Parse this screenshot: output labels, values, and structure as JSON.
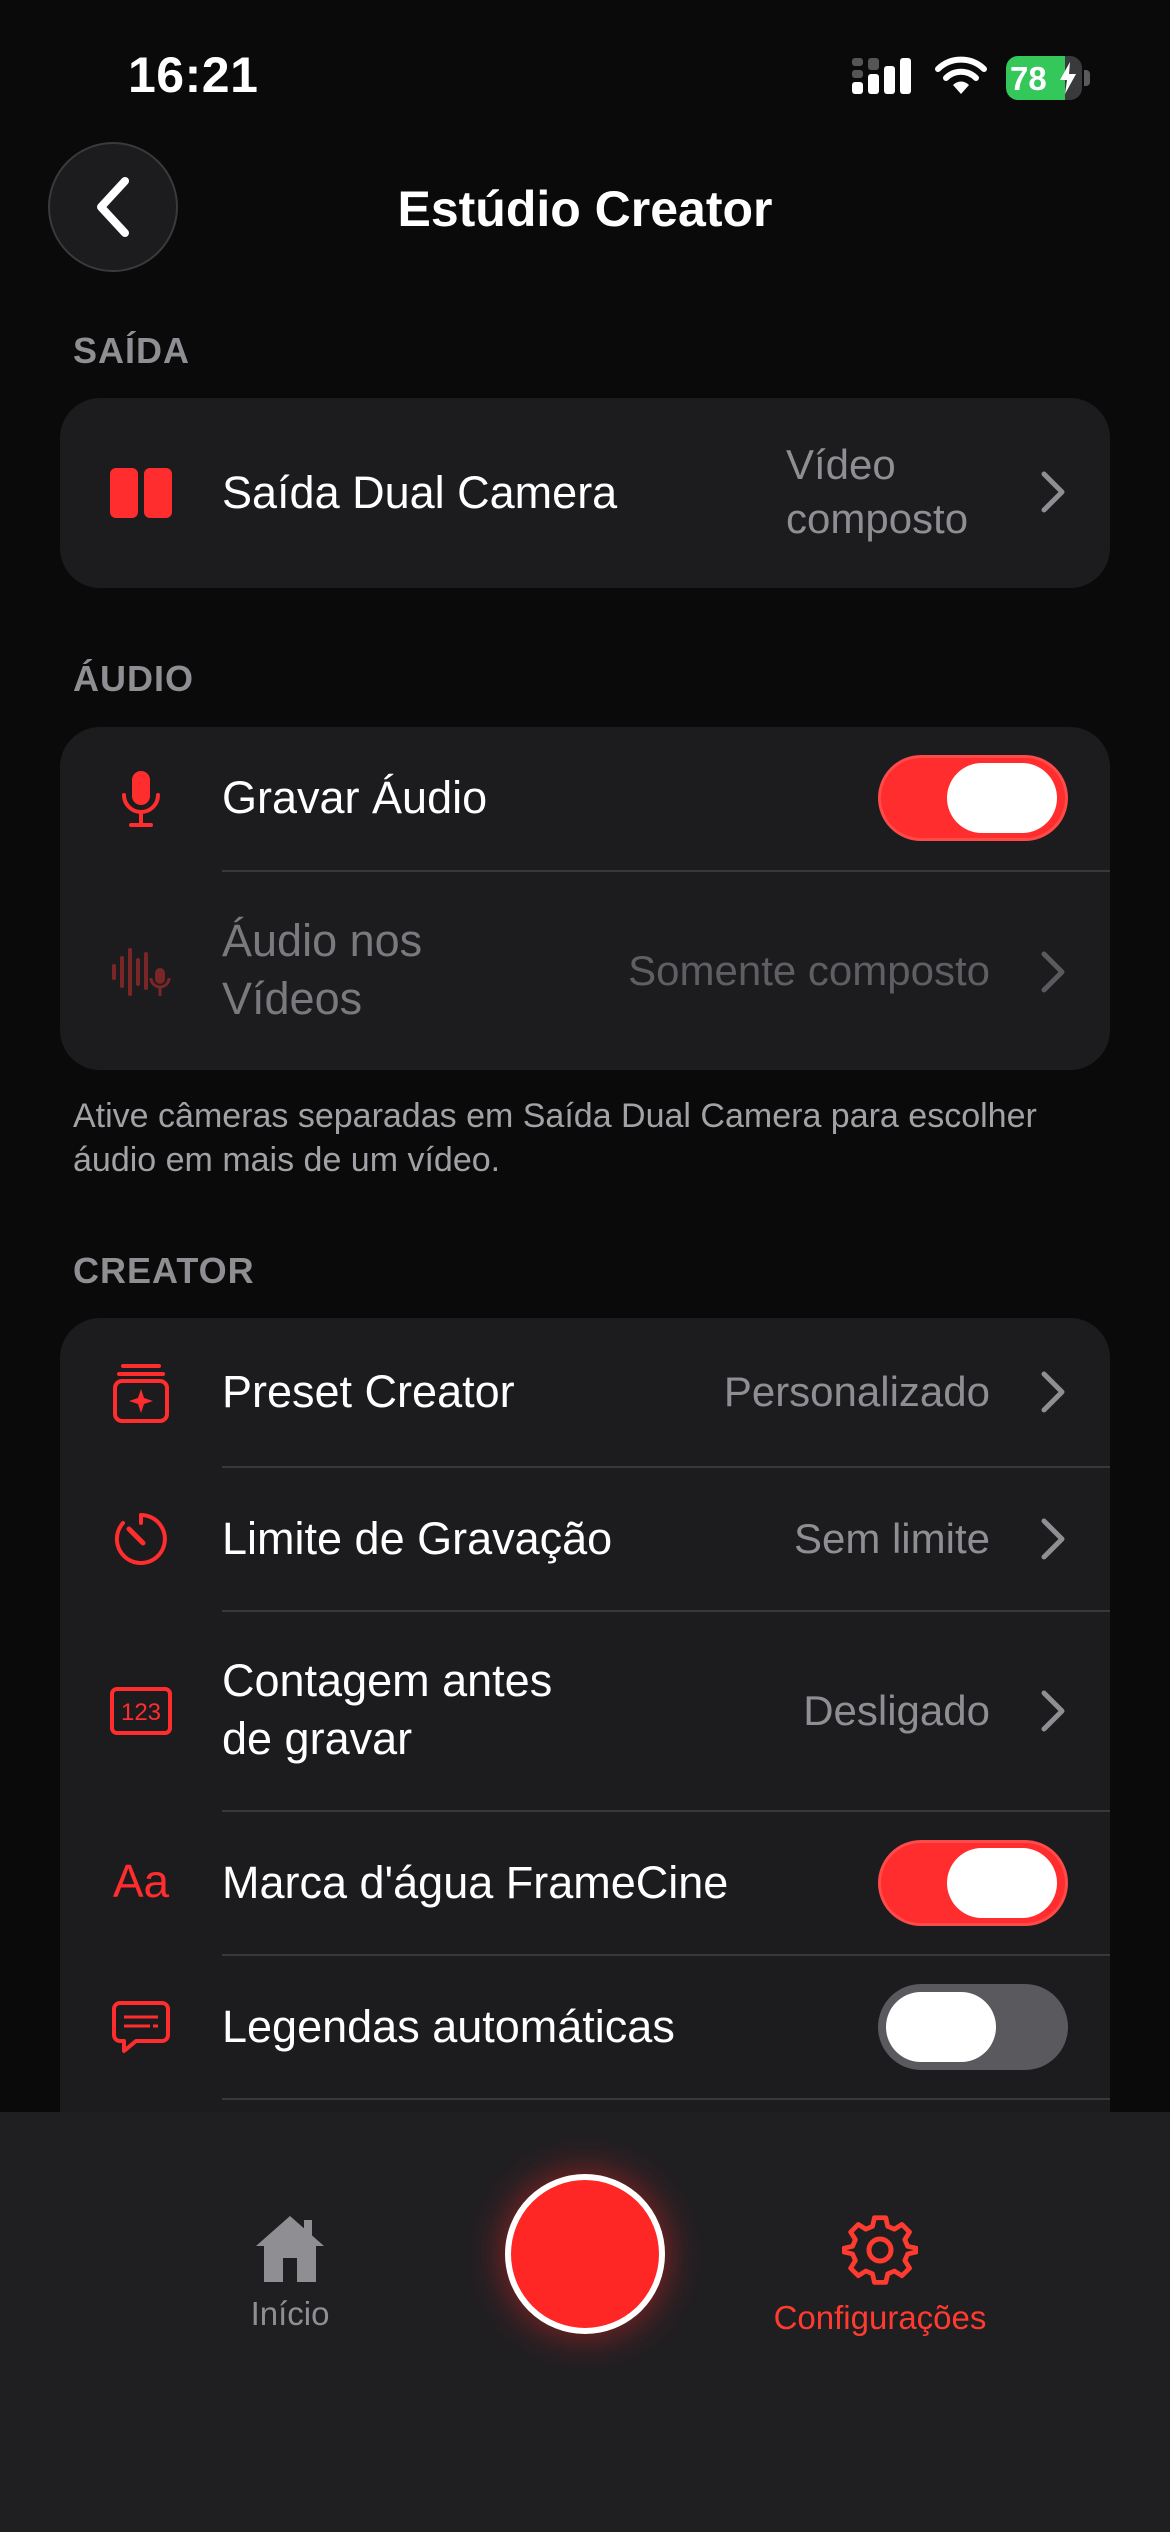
{
  "status_bar": {
    "time": "16:21",
    "battery": "78",
    "battery_fraction": 0.78
  },
  "header": {
    "title": "Estúdio Creator"
  },
  "sections": {
    "output": {
      "header": "SAÍDA",
      "dual_camera": {
        "label": "Saída Dual Camera",
        "value_line1": "Vídeo",
        "value_line2": "composto"
      }
    },
    "audio": {
      "header": "ÁUDIO",
      "record_audio": {
        "label": "Gravar Áudio",
        "on": true
      },
      "audio_in_videos": {
        "label_line1": "Áudio nos",
        "label_line2": "Vídeos",
        "value": "Somente composto"
      },
      "footnote": "Ative câmeras separadas em Saída Dual Camera para escolher áudio em mais de um vídeo."
    },
    "creator": {
      "header": "CREATOR",
      "preset": {
        "label": "Preset Creator",
        "value": "Personalizado"
      },
      "limit": {
        "label": "Limite de Gravação",
        "value": "Sem limite"
      },
      "countdown": {
        "label_line1": "Contagem antes",
        "label_line2": "de gravar",
        "value": "Desligado"
      },
      "watermark": {
        "icon_text": "Aa",
        "label": "Marca d'água FrameCine",
        "on": true
      },
      "captions": {
        "label": "Legendas automáticas",
        "on": false
      }
    }
  },
  "tab_bar": {
    "home_label": "Início",
    "settings_label": "Configurações"
  },
  "colors": {
    "accent": "#ff2d2d",
    "background": "#0a0a0b",
    "card": "#1c1c1e",
    "secondary_text": "#8e8e93"
  }
}
